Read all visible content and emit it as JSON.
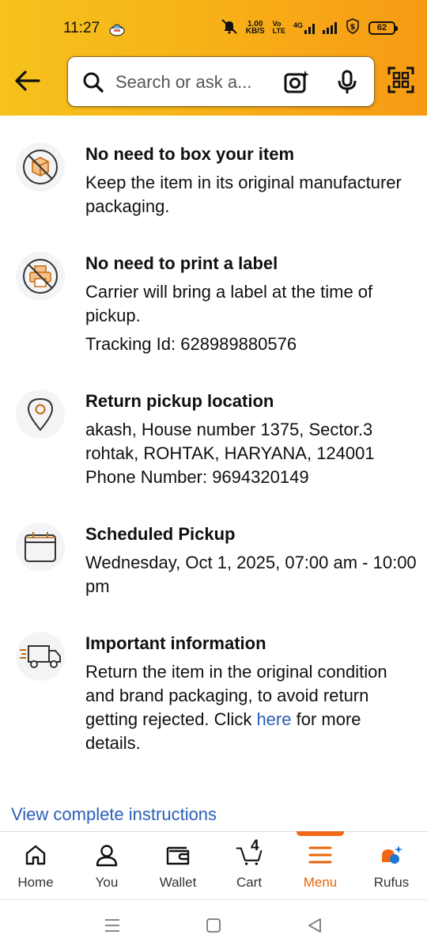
{
  "status_bar": {
    "time": "11:27",
    "net_speed_value": "1.00",
    "net_speed_unit": "KB/S",
    "volte_top": "Vo",
    "volte_bottom": "LTE",
    "network": "4G",
    "battery": "62"
  },
  "search": {
    "placeholder": "Search or ask a..."
  },
  "items": [
    {
      "title": "No need to box your item",
      "body": "Keep the item in its original manufacturer packaging.",
      "icon": "no-box-icon"
    },
    {
      "title": "No need to print a label",
      "body": "Carrier will bring a label at the time of pickup.",
      "extra": "Tracking Id: 628989880576",
      "icon": "no-print-icon"
    },
    {
      "title": "Return pickup location",
      "body_lines": [
        "akash, House number 1375, Sector.3",
        "rohtak, ROHTAK, HARYANA, 124001",
        "Phone Number: 9694320149"
      ],
      "icon": "location-pin-icon"
    },
    {
      "title": "Scheduled Pickup",
      "body": "Wednesday, Oct 1, 2025, 07:00 am - 10:00 pm",
      "icon": "calendar-icon"
    },
    {
      "title": "Important information",
      "body_prefix": "Return the item in the original condition and brand packaging, to avoid return getting rejected. Click ",
      "link_text": "here",
      "body_suffix": " for more details.",
      "icon": "delivery-truck-icon"
    }
  ],
  "view_instructions": "View complete instructions",
  "bottom_nav": {
    "home": "Home",
    "you": "You",
    "wallet": "Wallet",
    "cart": "Cart",
    "cart_count": "4",
    "menu": "Menu",
    "rufus": "Rufus"
  },
  "colors": {
    "accent_link": "#2a5fb8",
    "active_nav": "#e8650a",
    "header_start": "#f6c21d",
    "header_end": "#f79a14"
  }
}
